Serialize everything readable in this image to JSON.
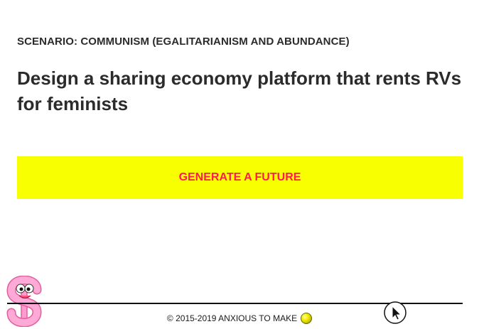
{
  "scenario": {
    "label": "SCENARIO: COMMUNISM (EGALITARIANISM AND ABUNDANCE)"
  },
  "prompt": {
    "text": "Design a sharing economy platform that rents RVs for feminists"
  },
  "generate_button": {
    "label": "GENERATE A FUTURE",
    "background_color": "#f8ff00",
    "text_color": "#ff1a4f"
  },
  "footer": {
    "copyright": "© 2015-2019 ANXIOUS TO MAKE",
    "icon": "yellow-ball-icon"
  },
  "decorations": {
    "mascot_icon": "pink-dollar-sign-mascot-icon",
    "cursor_icon": "mouse-pointer-cursor-icon"
  }
}
